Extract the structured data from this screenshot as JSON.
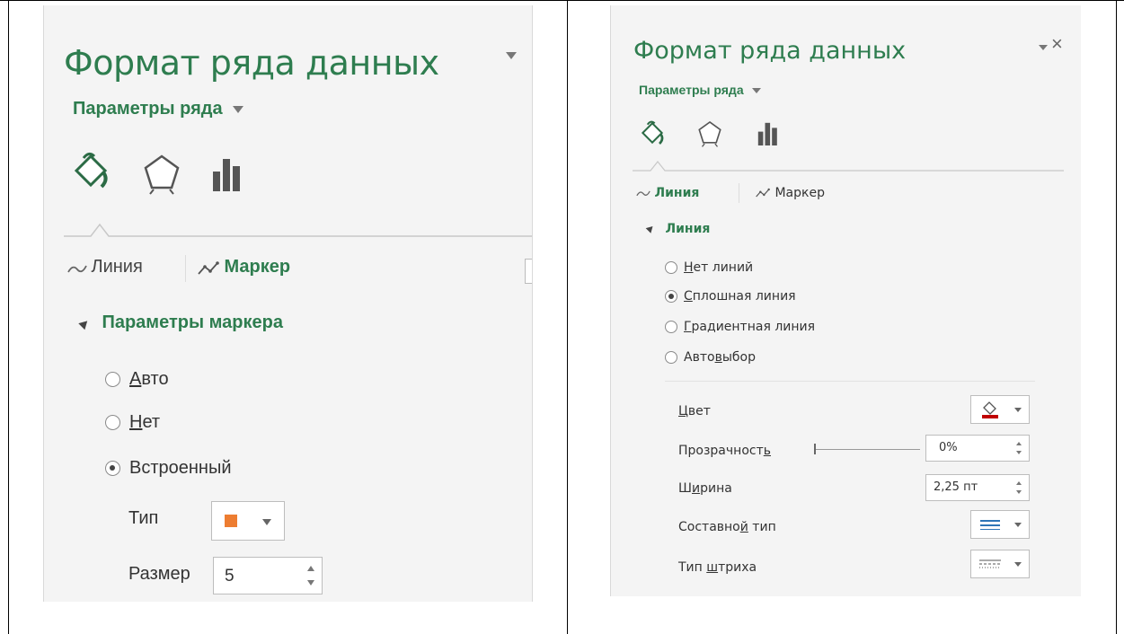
{
  "left": {
    "title": "Формат ряда данных",
    "subtitle": "Параметры ряда",
    "tabs": {
      "line": "Линия",
      "marker": "Маркер"
    },
    "section": "Параметры маркера",
    "options": {
      "auto_first": "А",
      "auto_rest": "вто",
      "none_first": "Н",
      "none_rest": "ет",
      "builtin": "Встроенный"
    },
    "type_label": "Тип",
    "size_label": "Размер",
    "size_value": "5",
    "marker_color": "#ed7d31"
  },
  "right": {
    "title": "Формат ряда данных",
    "subtitle": "Параметры ряда",
    "tabs": {
      "line": "Линия",
      "marker": "Маркер"
    },
    "section": "Линия",
    "options": {
      "none_first": "Н",
      "none_rest": "ет линий",
      "solid_first": "С",
      "solid_rest": "плошная линия",
      "grad_first": "Г",
      "grad_rest": "радиентная линия",
      "auto_a": "Авто",
      "auto_u": "в",
      "auto_b": "ыбор"
    },
    "color_first": "Ц",
    "color_rest": "вет",
    "transparency_a": "Прозрачност",
    "transparency_u": "ь",
    "transparency_value": "0%",
    "width_a": "Ш",
    "width_u": "и",
    "width_b": "рина",
    "width_value": "2,25 пт",
    "compound_a": "Составно",
    "compound_u": "й",
    "compound_b": " тип",
    "dash_a": "Тип ",
    "dash_u": "ш",
    "dash_b": "триха",
    "close": "×"
  }
}
